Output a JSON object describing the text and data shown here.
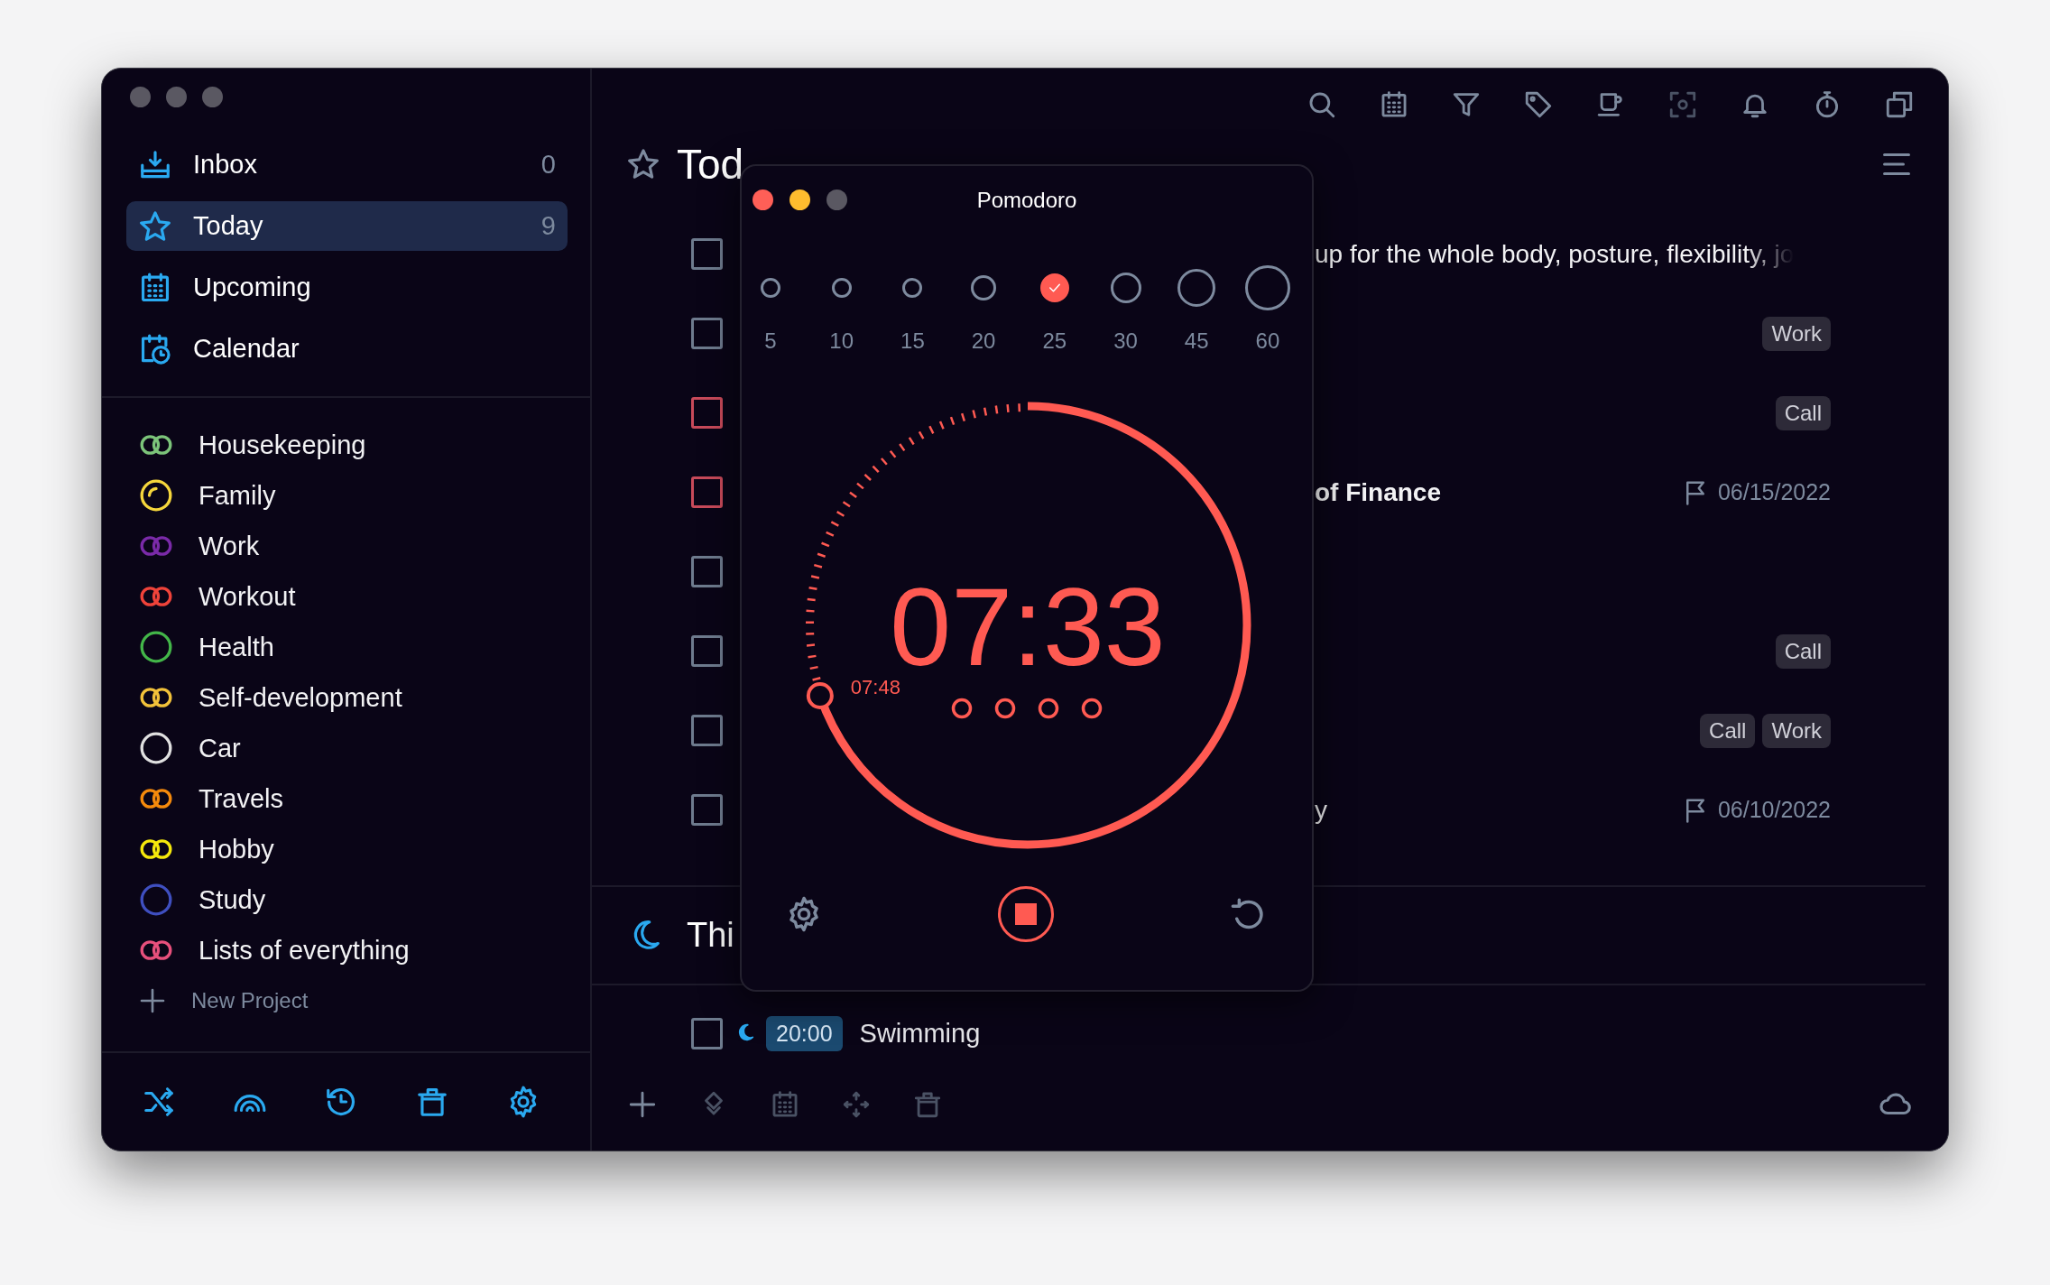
{
  "sidebar": {
    "nav": [
      {
        "label": "Inbox",
        "count": "0",
        "selected": false
      },
      {
        "label": "Today",
        "count": "9",
        "selected": true
      },
      {
        "label": "Upcoming",
        "selected": false
      },
      {
        "label": "Calendar",
        "selected": false
      }
    ],
    "projects": [
      {
        "name": "Housekeeping",
        "color": "#7cc47a",
        "kind": "double"
      },
      {
        "name": "Family",
        "color": "#f5d63c",
        "kind": "partial"
      },
      {
        "name": "Work",
        "color": "#7a2aa8",
        "kind": "double"
      },
      {
        "name": "Workout",
        "color": "#f0433a",
        "kind": "double"
      },
      {
        "name": "Health",
        "color": "#43b649",
        "kind": "single"
      },
      {
        "name": "Self-development",
        "color": "#f2c23a",
        "kind": "double"
      },
      {
        "name": "Car",
        "color": "#e0e0e0",
        "kind": "single"
      },
      {
        "name": "Travels",
        "color": "#f58a0c",
        "kind": "double"
      },
      {
        "name": "Hobby",
        "color": "#f5e80c",
        "kind": "double"
      },
      {
        "name": "Study",
        "color": "#3f4fc0",
        "kind": "single"
      },
      {
        "name": "Lists of everything",
        "color": "#e8507c",
        "kind": "double"
      }
    ],
    "new_project": {
      "label": "New Project"
    }
  },
  "header": {
    "title": "Tod"
  },
  "tasks": [
    {
      "text": "up for the whole body, posture, flexibility, jo",
      "checked": false,
      "color": "#6e7b8e",
      "bold": false,
      "faded": true
    },
    {
      "checked": false,
      "color": "#6e7b8e",
      "tags": [
        "Work"
      ]
    },
    {
      "checked": false,
      "color": "#c84a5a",
      "tags": [
        "Call"
      ]
    },
    {
      "text": "of Finance",
      "checked": false,
      "color": "#c84a5a",
      "bold": true,
      "date": "06/15/2022"
    },
    {
      "checked": false,
      "color": "#6e7b8e"
    },
    {
      "checked": false,
      "color": "#6e7b8e",
      "tags": [
        "Call"
      ]
    },
    {
      "checked": false,
      "color": "#6e7b8e",
      "tags": [
        "Call",
        "Work"
      ]
    },
    {
      "text": "y",
      "checked": false,
      "color": "#6e7b8e",
      "bold": false,
      "date": "06/10/2022"
    }
  ],
  "evening_section": {
    "title": "Thi"
  },
  "evening_tasks": [
    {
      "time": "20:00",
      "text": "Swimming",
      "checked": false
    }
  ],
  "pomodoro": {
    "title": "Pomodoro",
    "durations": [
      {
        "label": "5",
        "selected": false
      },
      {
        "label": "10",
        "selected": false
      },
      {
        "label": "15",
        "selected": false
      },
      {
        "label": "20",
        "selected": false
      },
      {
        "label": "25",
        "selected": true
      },
      {
        "label": "30",
        "selected": false
      },
      {
        "label": "45",
        "selected": false
      },
      {
        "label": "60",
        "selected": false
      }
    ],
    "time": "07:33",
    "marker_time": "07:48",
    "level": 0.698,
    "sessions": [
      {
        "completed": false
      },
      {
        "completed": false
      },
      {
        "completed": false
      },
      {
        "completed": false
      }
    ]
  }
}
